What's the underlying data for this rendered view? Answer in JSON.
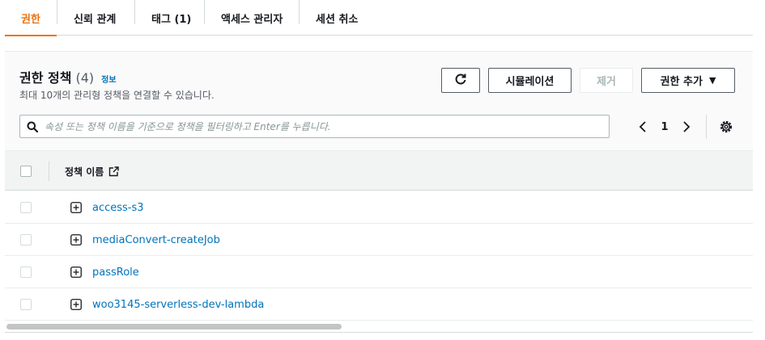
{
  "tabs": [
    {
      "label": "권한",
      "active": true
    },
    {
      "label": "신뢰 관계",
      "active": false
    },
    {
      "label": "태그 (1)",
      "active": false
    },
    {
      "label": "액세스 관리자",
      "active": false
    },
    {
      "label": "세션 취소",
      "active": false
    }
  ],
  "policies_panel": {
    "title": "권한 정책",
    "count": "(4)",
    "info_link": "정보",
    "description": "최대 10개의 관리형 정책을 연결할 수 있습니다.",
    "refresh_icon": "refresh-icon",
    "simulate_label": "시뮬레이션",
    "remove_label": "제거",
    "add_permissions_label": "권한 추가",
    "add_caret": "▼"
  },
  "search": {
    "placeholder": "속성 또는 정책 이름을 기준으로 정책을 필터링하고 Enter를 누릅니다.",
    "icon": "search-icon"
  },
  "pagination": {
    "current_page": "1",
    "prev_icon": "chevron-left-icon",
    "next_icon": "chevron-right-icon",
    "settings_icon": "gear-icon"
  },
  "table": {
    "column_header": "정책 이름",
    "header_icon": "external-link-icon",
    "rows": [
      {
        "name": "access-s3"
      },
      {
        "name": "mediaConvert-createJob"
      },
      {
        "name": "passRole"
      },
      {
        "name": "woo3145-serverless-dev-lambda"
      }
    ]
  },
  "colors": {
    "accent": "#ec7211",
    "link": "#0073bb",
    "text": "#16191f",
    "muted": "#545b64"
  }
}
